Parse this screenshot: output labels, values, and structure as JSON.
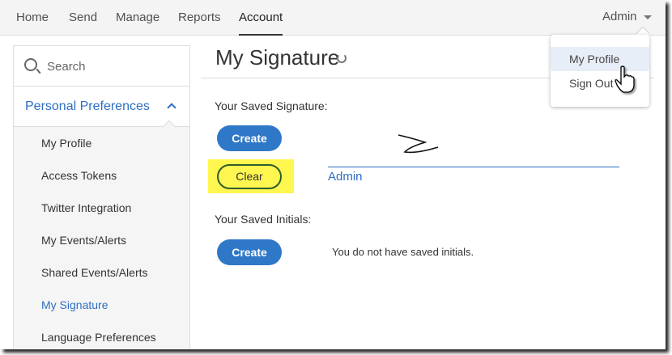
{
  "nav": {
    "items": [
      "Home",
      "Send",
      "Manage",
      "Reports",
      "Account"
    ],
    "active": "Account",
    "user": "Admin"
  },
  "sidebar": {
    "search_placeholder": "Search",
    "section": "Personal Preferences",
    "items": [
      "My Profile",
      "Access Tokens",
      "Twitter Integration",
      "My Events/Alerts",
      "Shared Events/Alerts",
      "My Signature",
      "Language Preferences"
    ],
    "active": "My Signature"
  },
  "main": {
    "title": "My Signature",
    "saved_signature_label": "Your Saved Signature:",
    "create_label": "Create",
    "clear_label": "Clear",
    "signature_name": "Admin",
    "saved_initials_label": "Your Saved Initials:",
    "no_initials_text": "You do not have saved initials."
  },
  "dropdown": {
    "items": [
      "My Profile",
      "Sign Out"
    ],
    "hovered": "My Profile"
  },
  "colors": {
    "accent": "#2f78c8",
    "highlight": "#fff64f"
  }
}
